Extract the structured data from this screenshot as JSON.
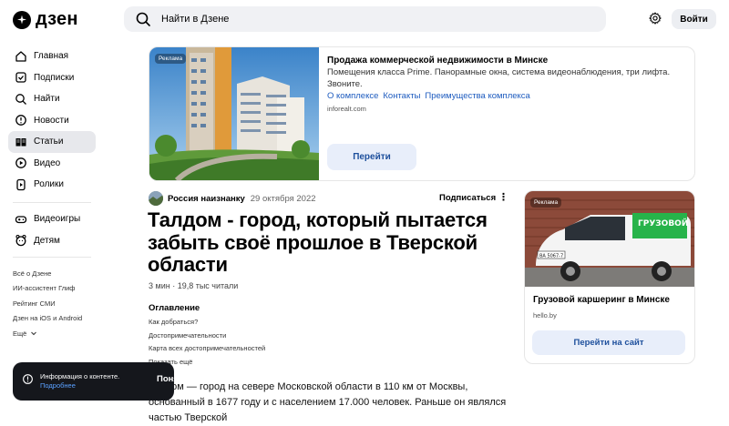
{
  "header": {
    "logo_text": "дзен",
    "search_placeholder": "Найти в Дзене",
    "login_label": "Войти"
  },
  "sidebar": {
    "items": [
      {
        "label": "Главная",
        "icon": "home-icon"
      },
      {
        "label": "Подписки",
        "icon": "subscriptions-icon"
      },
      {
        "label": "Найти",
        "icon": "search-icon"
      },
      {
        "label": "Новости",
        "icon": "news-icon"
      },
      {
        "label": "Статьи",
        "icon": "articles-icon",
        "active": true
      },
      {
        "label": "Видео",
        "icon": "video-icon"
      },
      {
        "label": "Ролики",
        "icon": "shorts-icon"
      }
    ],
    "items2": [
      {
        "label": "Видеоигры",
        "icon": "gamepad-icon"
      },
      {
        "label": "Детям",
        "icon": "kids-icon"
      }
    ],
    "footer_links": [
      "Всё о Дзене",
      "ИИ-ассистент Глиф",
      "Рейтинг СМИ",
      "Дзен на iOS и Android",
      "Ещё"
    ]
  },
  "top_ad": {
    "badge": "Реклама",
    "title": "Продажа коммерческой недвижимости в Минске",
    "description": "Помещения класса Prime. Панорамные окна, система видеонаблюдения, три лифта. Звоните.",
    "links": [
      "О комплексе",
      "Контакты",
      "Преимущества комплекса"
    ],
    "domain": "inforealt.com",
    "button": "Перейти"
  },
  "article": {
    "author": "Россия наизнанку",
    "date": "29 октября 2022",
    "subscribe": "Подписаться",
    "more": "⋮",
    "title": "Талдом - город, который пытается забыть своё прошлое в Тверской области",
    "meta": "3 мин · 19,8 тыс читали",
    "toc_heading": "Оглавление",
    "toc": [
      "Как добраться?",
      "Достопримечательности",
      "Карта всех достопримечательностей",
      "Показать ещё"
    ],
    "body": "Талдом — город на севере Московской области в 110 км от Москвы, основанный в 1677 году и с населением 17.000 человек. Раньше он являлся частью Тверской"
  },
  "side_ad": {
    "badge": "Реклама",
    "title": "Грузовой каршеринг в Минске",
    "domain": "hello.by",
    "button": "Перейти на сайт",
    "van_text": "ГРУЗОВОЙ",
    "plate": "ВА 5067-7"
  },
  "toast": {
    "text": "Информация о контенте.",
    "link": "Подробнее",
    "button": "Понятно"
  }
}
